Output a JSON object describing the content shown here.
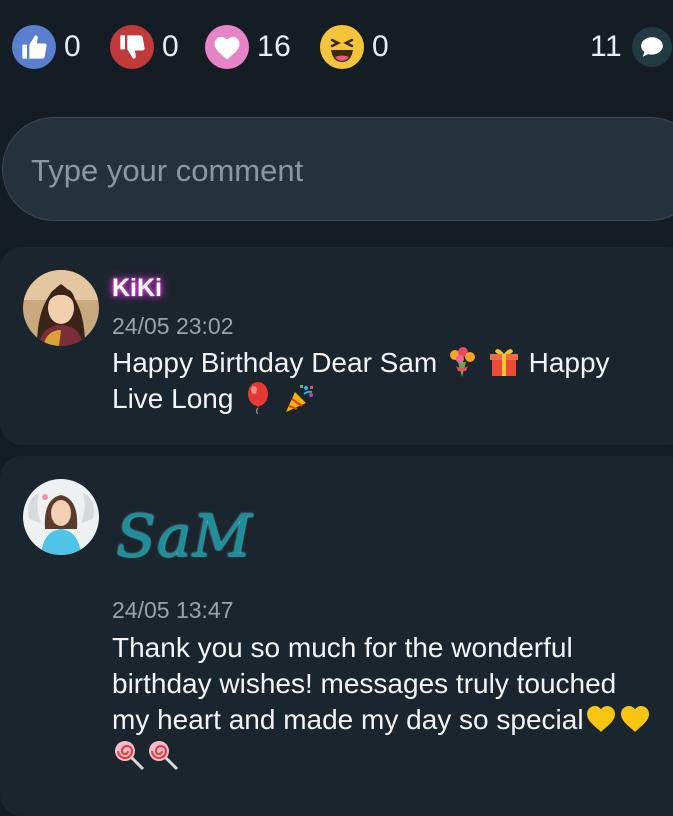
{
  "reactions": {
    "like": {
      "icon": "thumbs-up-icon",
      "count": "0",
      "color": "#5b7fcf"
    },
    "dislike": {
      "icon": "thumbs-down-icon",
      "count": "0",
      "color": "#c0393b"
    },
    "love": {
      "icon": "heart-icon",
      "count": "16",
      "color": "#e684c8"
    },
    "laugh": {
      "icon": "laughing-face-icon",
      "count": "0",
      "color": "#f4c53b"
    },
    "comments": {
      "icon": "comment-bubble-icon",
      "count": "11"
    }
  },
  "comment_input": {
    "placeholder": "Type your comment"
  },
  "comments": [
    {
      "username": "KiKi",
      "timestamp": "24/05 23:02",
      "text_part1": "Happy Birthday Dear Sam",
      "text_part2": "Happy Live Long",
      "emojis": [
        "bouquet-emoji",
        "gift-emoji",
        "balloon-emoji",
        "party-popper-emoji"
      ]
    },
    {
      "username": "SaM",
      "timestamp": "24/05 13:47",
      "text": "Thank you so much for the wonderful birthday wishes! messages truly touched my heart and made my day so special",
      "emojis": [
        "yellow-heart-emoji",
        "yellow-heart-emoji",
        "lollipop-emoji",
        "lollipop-emoji"
      ]
    }
  ],
  "theme": {
    "background": "#141d24",
    "card": "#1b252d",
    "name_glow": "#d13ad6",
    "sam_logo": "#1fa3a8"
  }
}
